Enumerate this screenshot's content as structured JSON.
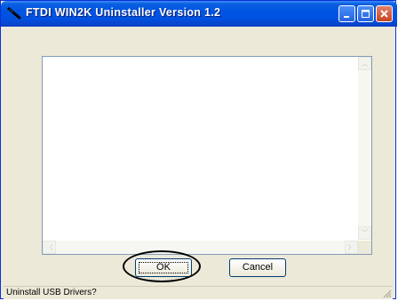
{
  "window": {
    "title": "FTDI WIN2K Uninstaller Version 1.2",
    "icon": "plug-icon",
    "controls": [
      "minimize-icon",
      "maximize-icon",
      "close-icon"
    ]
  },
  "main": {
    "output_text": "",
    "scroll_up_glyph": "︿",
    "scroll_down_glyph": "﹀",
    "scroll_left_glyph": "〈",
    "scroll_right_glyph": "〉"
  },
  "buttons": {
    "ok_label": "OK",
    "cancel_label": "Cancel"
  },
  "status": {
    "text": "Uninstall USB Drivers?"
  },
  "colors": {
    "titlebar": "#0054e3",
    "window_face": "#ece9d8",
    "close_button": "#c8431f"
  }
}
